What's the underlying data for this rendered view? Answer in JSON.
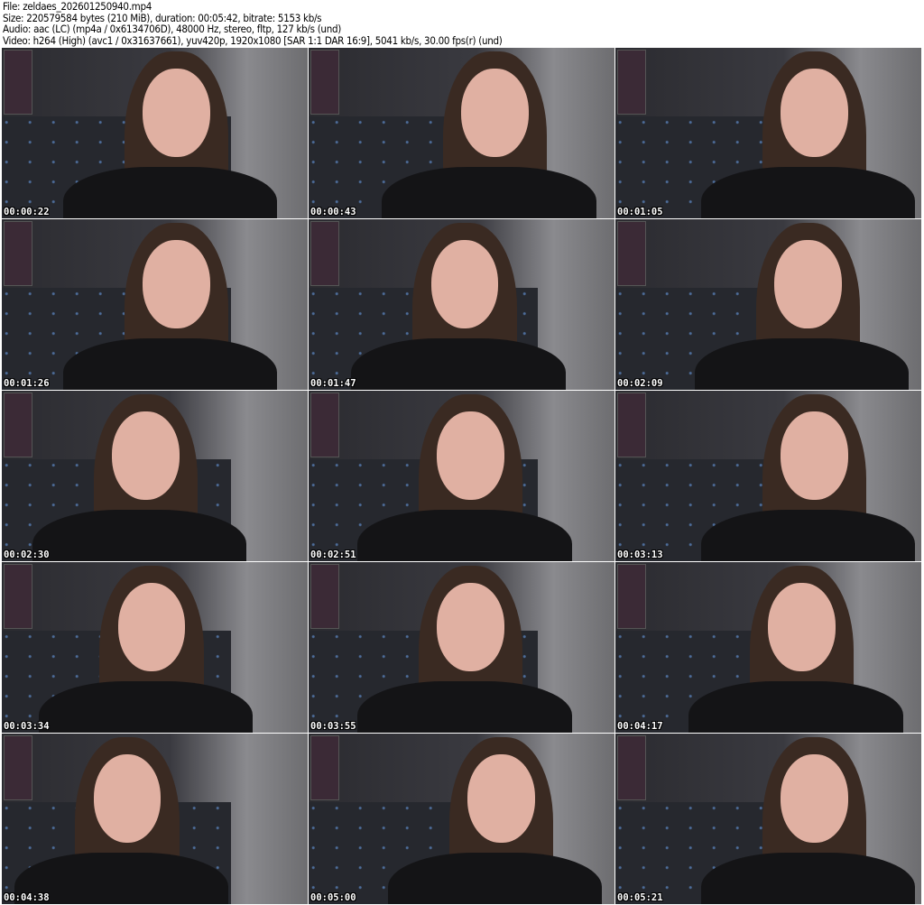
{
  "header": {
    "file": "File: zeldaes_202601250940.mp4",
    "size": "Size: 220579584 bytes (210 MiB), duration: 00:05:42, bitrate: 5153 kb/s",
    "audio": "Audio: aac (LC) (mp4a / 0x6134706D), 48000 Hz, stereo, fltp, 127 kb/s (und)",
    "video": "Video: h264 (High) (avc1 / 0x31637661), yuv420p, 1920x1080 [SAR 1:1 DAR 16:9], 5041 kb/s, 30.00 fps(r) (und)"
  },
  "thumbnails": [
    "00:00:22",
    "00:00:43",
    "00:01:05",
    "00:01:26",
    "00:01:47",
    "00:02:09",
    "00:02:30",
    "00:02:51",
    "00:03:13",
    "00:03:34",
    "00:03:55",
    "00:04:17",
    "00:04:38",
    "00:05:00",
    "00:05:21"
  ]
}
